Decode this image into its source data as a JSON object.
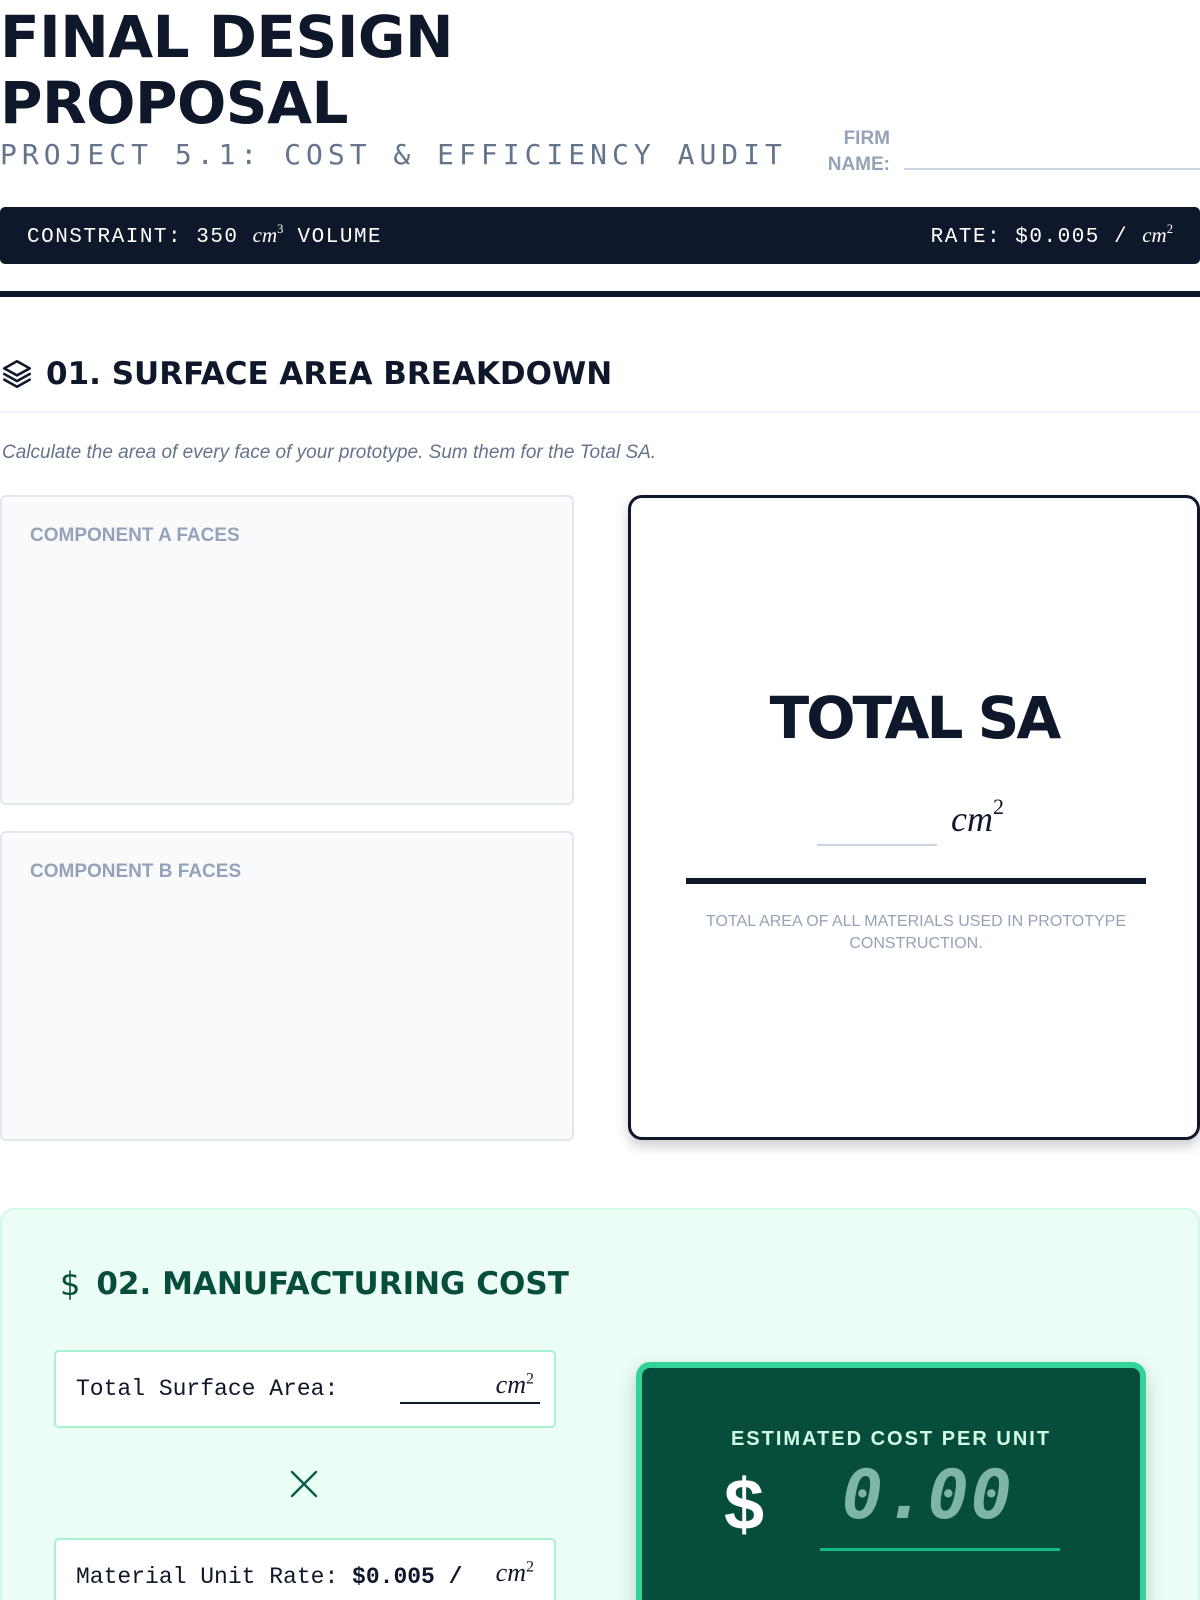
{
  "header": {
    "title_line1": "FINAL DESIGN",
    "title_line2": "PROPOSAL",
    "subtitle": "PROJECT 5.1: COST & EFFICIENCY AUDIT",
    "firm_label_line1": "FIRM",
    "firm_label_line2": "NAME:"
  },
  "banner": {
    "constraint_prefix": "CONSTRAINT: 350 ",
    "constraint_unit": "cm",
    "constraint_exp": "3",
    "constraint_suffix": " VOLUME",
    "rate_prefix": "RATE: $0.005 / ",
    "rate_unit": "cm",
    "rate_exp": "2"
  },
  "section1": {
    "icon": "layers-icon",
    "title": "01. SURFACE AREA BREAKDOWN",
    "instructions": "Calculate the area of every face of your prototype. Sum them for the Total SA.",
    "component_a_label": "COMPONENT A FACES",
    "component_b_label": "COMPONENT B FACES",
    "total_title": "TOTAL SA",
    "total_unit": "cm",
    "total_exp": "2",
    "total_note": "TOTAL AREA OF ALL MATERIALS USED IN PROTOTYPE CONSTRUCTION."
  },
  "section2": {
    "icon": "dollar-icon",
    "icon_glyph": "$",
    "title": "02. MANUFACTURING COST",
    "field1_label": "Total Surface Area:",
    "field1_unit": "cm",
    "field1_exp": "2",
    "field2_label": "Material Unit Rate: ",
    "field2_rate": "$0.005 / ",
    "field2_unit": "cm",
    "field2_exp": "2",
    "cost_label": "ESTIMATED COST PER UNIT",
    "cost_dollar": "$",
    "cost_placeholder": "0.00"
  },
  "colors": {
    "ink": "#0f172a",
    "muted": "#94a3b8",
    "green_dark": "#064e3b",
    "green_accent": "#34d399",
    "green_bg": "#ecfdf5"
  }
}
